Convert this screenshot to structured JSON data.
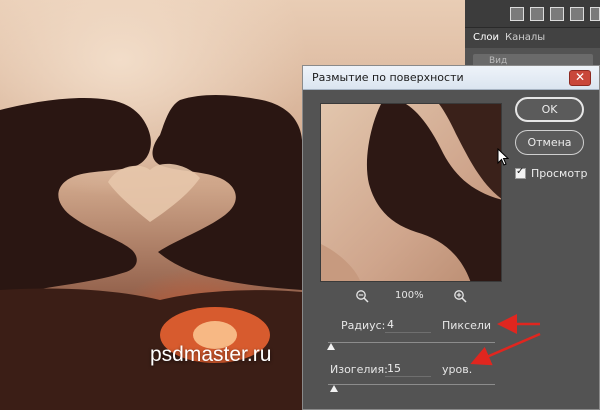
{
  "watermark": "psdmaster.ru",
  "panel": {
    "tabs": [
      "Слои",
      "Каналы"
    ],
    "search_placeholder": "Вид"
  },
  "dialog": {
    "title": "Размытие по поверхности",
    "ok_label": "OK",
    "cancel_label": "Отмена",
    "preview_label": "Просмотр",
    "preview_checked": true,
    "zoom": "100%",
    "radius": {
      "label": "Радиус:",
      "value": "4",
      "unit": "Пиксели"
    },
    "threshold": {
      "label": "Изогелия:",
      "value": "15",
      "unit": "уров."
    }
  },
  "colors": {
    "annotation_arrow": "#e0261f",
    "dialog_bg": "#535353"
  }
}
